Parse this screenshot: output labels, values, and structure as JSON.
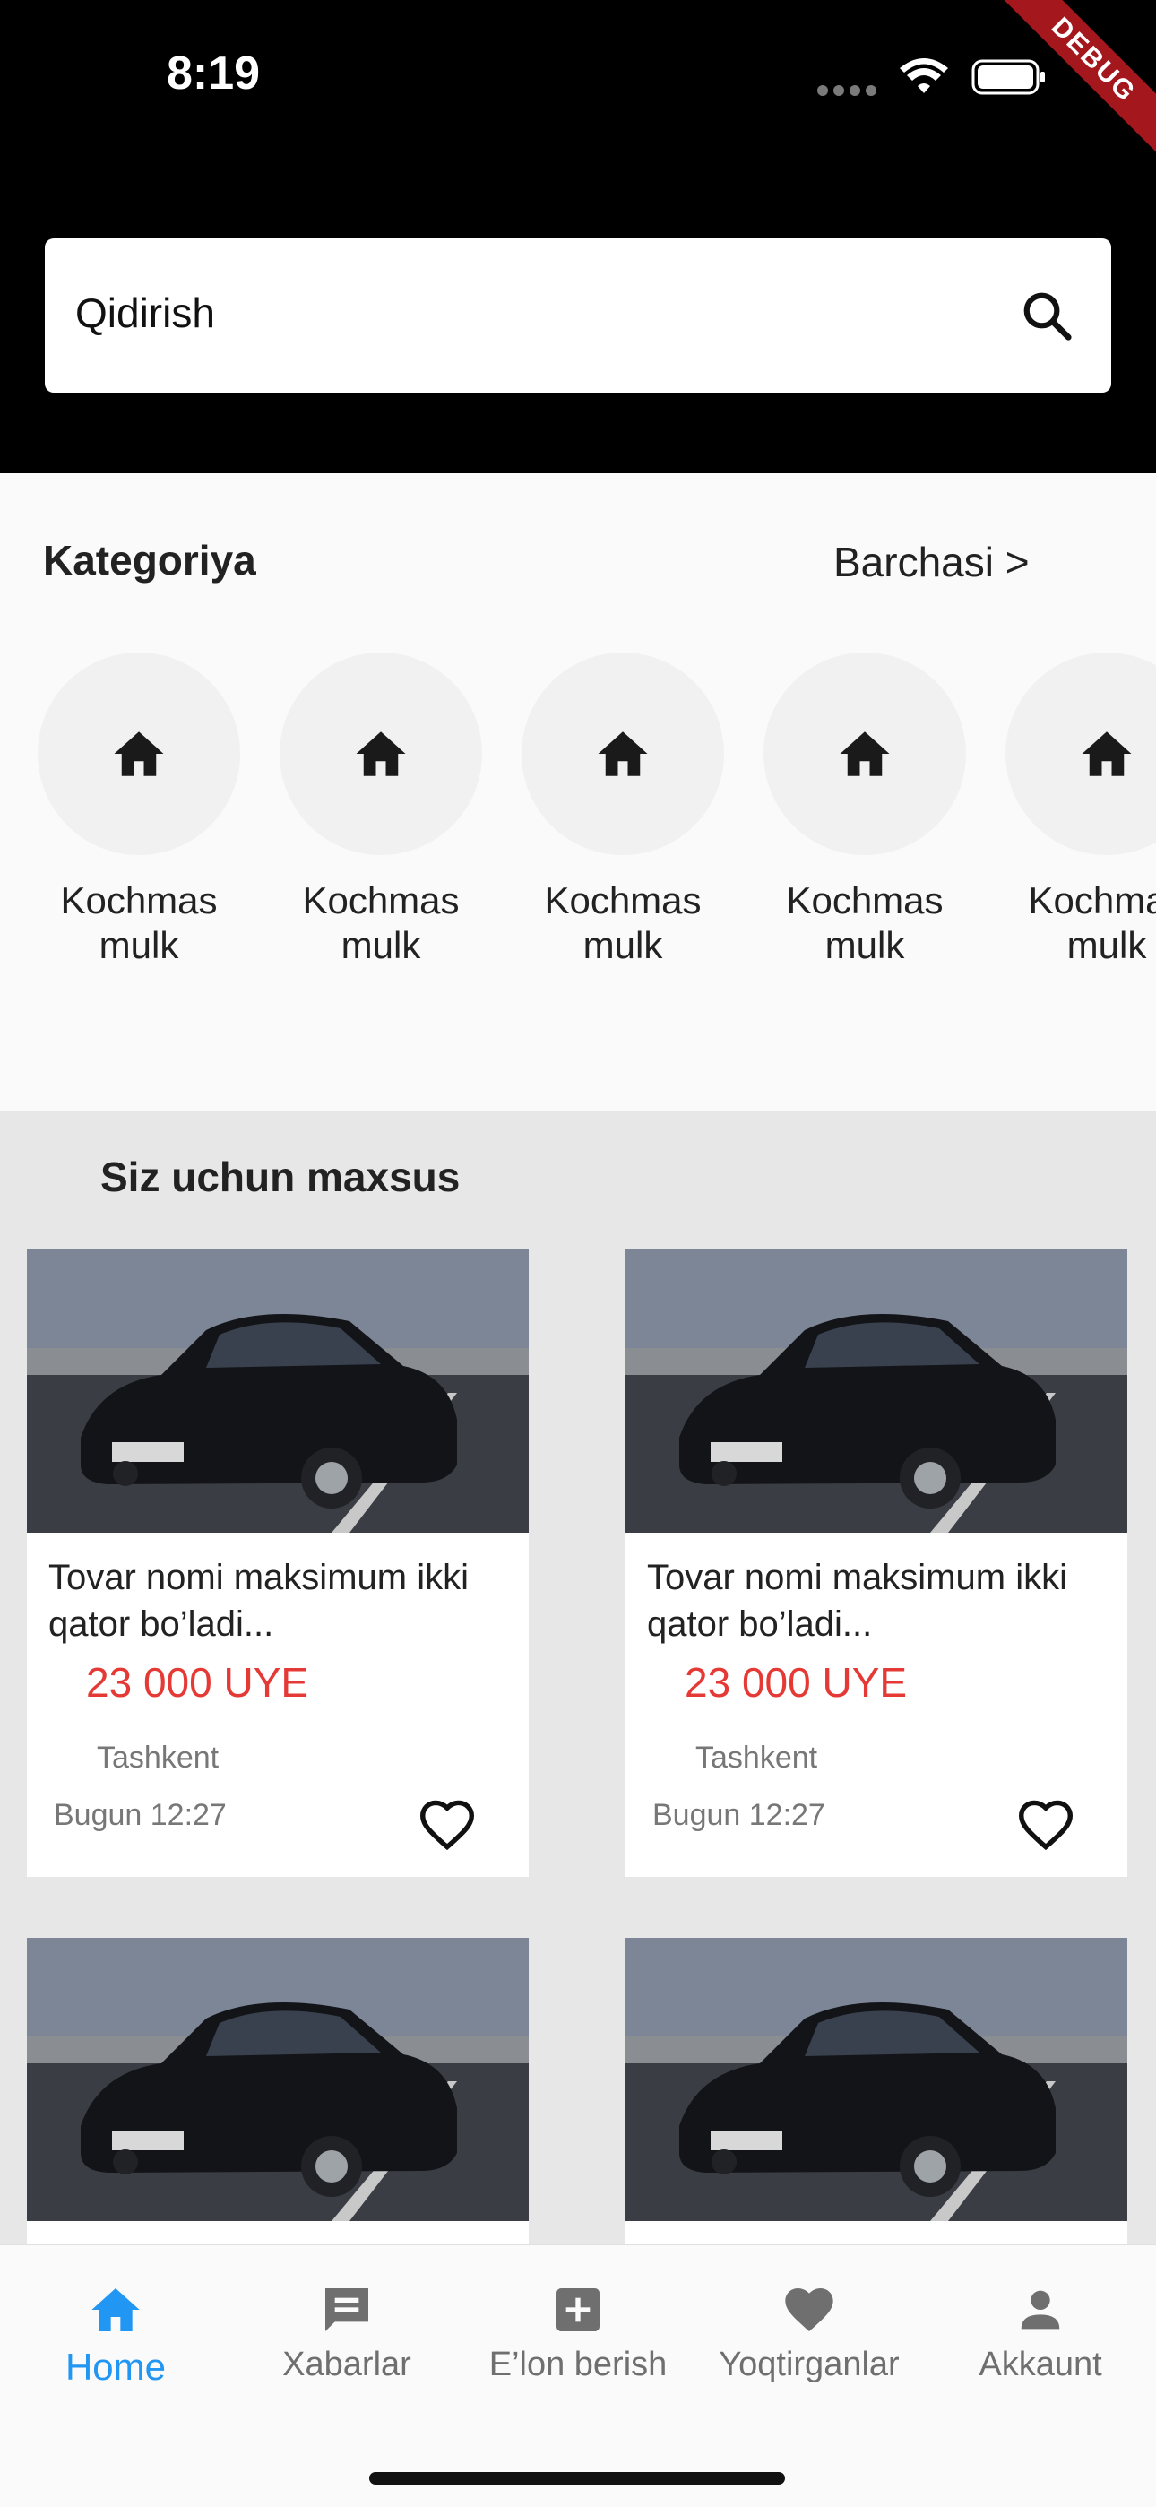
{
  "status_bar": {
    "time": "8:19",
    "debug_banner": "DEBUG"
  },
  "search": {
    "placeholder": "Qidirish"
  },
  "category": {
    "title": "Kategoriya",
    "see_all": "Barchasi >",
    "items": [
      {
        "label": "Kochmas mulk",
        "icon": "home-icon"
      },
      {
        "label": "Kochmas mulk",
        "icon": "home-icon"
      },
      {
        "label": "Kochmas mulk",
        "icon": "home-icon"
      },
      {
        "label": "Kochmas mulk",
        "icon": "home-icon"
      },
      {
        "label": "Kochmas mulk",
        "icon": "home-icon"
      }
    ]
  },
  "special": {
    "title": "Siz uchun maxsus",
    "cards": [
      {
        "title": "Tovar nomi maksimum ikki qator bo’ladi...",
        "price": "23 000 UYE",
        "city": "Tashkent",
        "time": "Bugun 12:27"
      },
      {
        "title": "Tovar nomi maksimum ikki qator bo’ladi...",
        "price": "23 000 UYE",
        "city": "Tashkent",
        "time": "Bugun 12:27"
      },
      {
        "title": "",
        "price": "",
        "city": "",
        "time": ""
      },
      {
        "title": "",
        "price": "",
        "city": "",
        "time": ""
      }
    ]
  },
  "bottom_nav": [
    {
      "label": "Home",
      "icon": "home-icon",
      "active": true
    },
    {
      "label": "Xabarlar",
      "icon": "message-icon",
      "active": false
    },
    {
      "label": "E’lon berish",
      "icon": "add-box-icon",
      "active": false
    },
    {
      "label": "Yoqtirganlar",
      "icon": "heart-icon",
      "active": false
    },
    {
      "label": "Akkaunt",
      "icon": "person-icon",
      "active": false
    }
  ],
  "colors": {
    "accent": "#2196f3",
    "price": "#e53935"
  }
}
